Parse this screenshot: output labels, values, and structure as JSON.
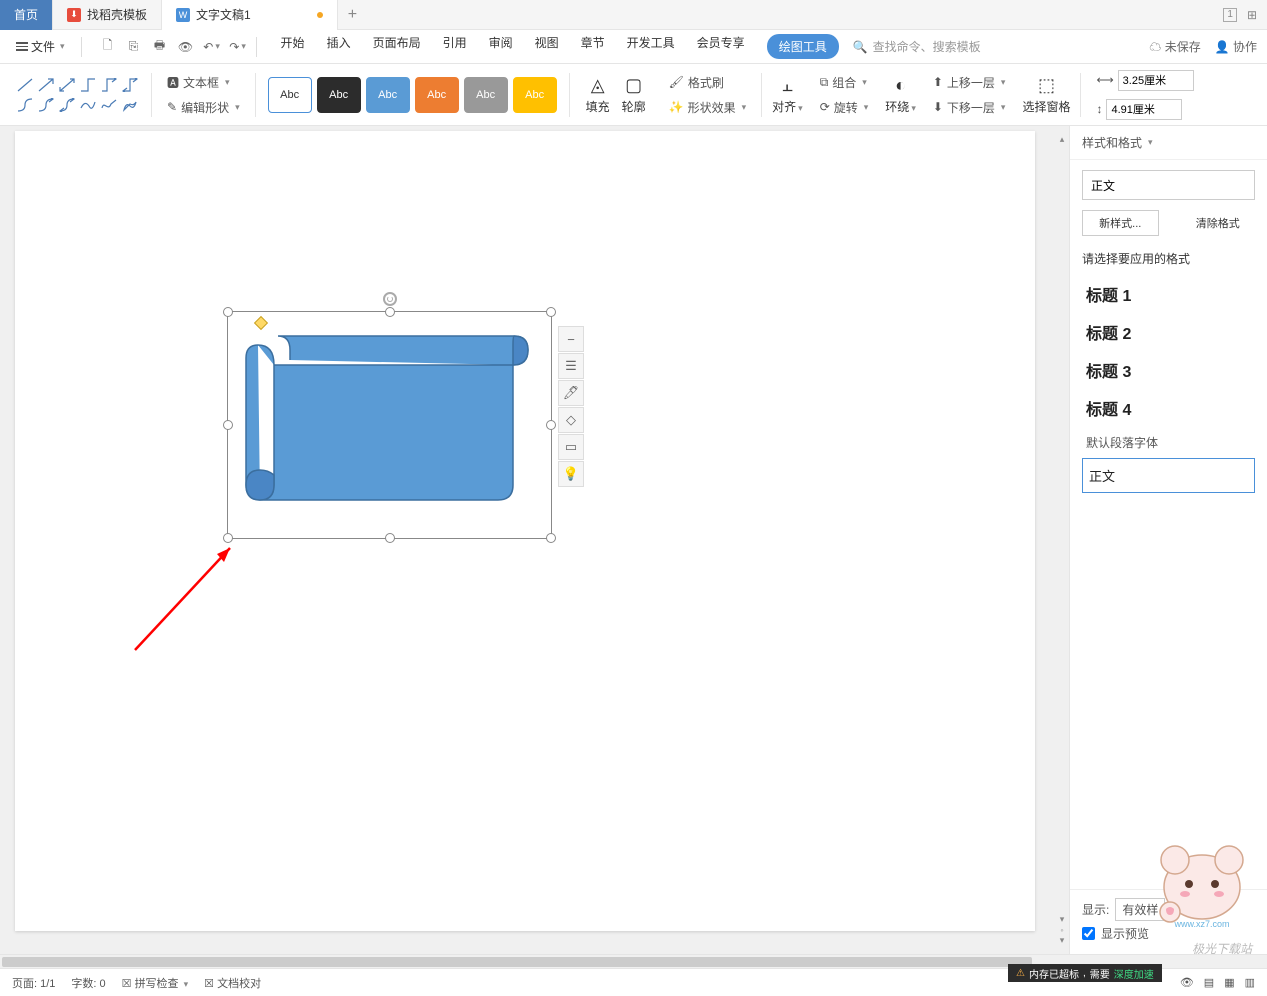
{
  "tabs": {
    "home": "首页",
    "templates": "找稻壳模板",
    "doc": "文字文稿1"
  },
  "menubar": {
    "file": "文件",
    "menus": [
      "开始",
      "插入",
      "页面布局",
      "引用",
      "审阅",
      "视图",
      "章节",
      "开发工具",
      "会员专享"
    ],
    "drawing_tools": "绘图工具",
    "search_placeholder": "查找命令、搜索模板",
    "unsaved": "未保存",
    "coop": "协作"
  },
  "ribbon": {
    "textbox": "文本框",
    "edit_shape": "编辑形状",
    "style_label": "Abc",
    "fill": "填充",
    "outline": "轮廓",
    "format_painter": "格式刷",
    "shape_effects": "形状效果",
    "align": "对齐",
    "group": "组合",
    "rotate": "旋转",
    "wrap": "环绕",
    "bring_forward": "上移一层",
    "send_backward": "下移一层",
    "selection_pane": "选择窗格",
    "width_value": "3.25厘米",
    "height_value": "4.91厘米"
  },
  "panel": {
    "title": "样式和格式",
    "current_style": "正文",
    "new_style": "新样式...",
    "clear_format": "清除格式",
    "select_label": "请选择要应用的格式",
    "styles": [
      "标题 1",
      "标题 2",
      "标题 3",
      "标题 4"
    ],
    "default_font": "默认段落字体",
    "body_text": "正文",
    "show_label": "显示:",
    "show_value": "有效样",
    "preview_label": "显示预览"
  },
  "statusbar": {
    "page": "页面: 1/1",
    "words": "字数: 0",
    "spellcheck": "拼写检查",
    "proof": "文档校对"
  },
  "taskbar": {
    "memory": "内存已超标",
    "need": "需要",
    "boost": "深度加速"
  },
  "watermark": "极光下载站"
}
